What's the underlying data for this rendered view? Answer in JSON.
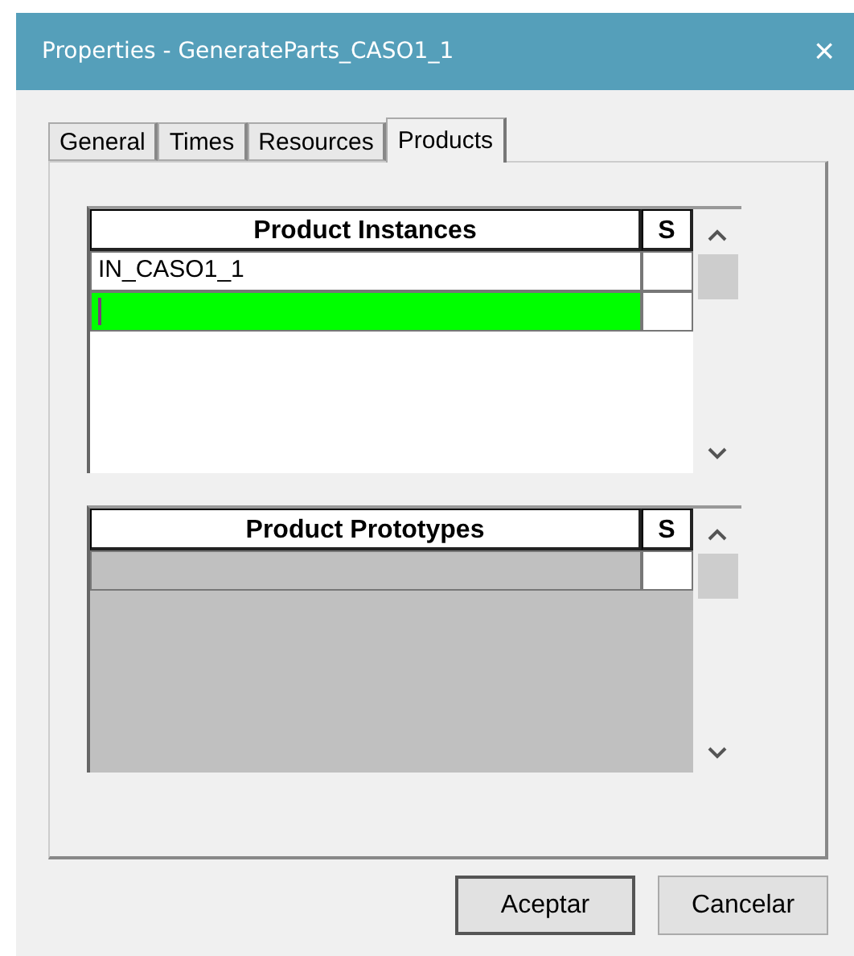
{
  "window": {
    "title": "Properties - GenerateParts_CASO1_1",
    "close": "×"
  },
  "tabs": [
    {
      "label": "General",
      "selected": false
    },
    {
      "label": "Times",
      "selected": false
    },
    {
      "label": "Resources",
      "selected": false
    },
    {
      "label": "Products",
      "selected": true
    }
  ],
  "grids": [
    {
      "columns": [
        "Product Instances",
        "S"
      ],
      "disabled": false,
      "rows": [
        {
          "name": "IN_CASO1_1",
          "selected": false
        },
        {
          "selected": true
        }
      ]
    },
    {
      "columns": [
        "Product Prototypes",
        "S"
      ],
      "disabled": true,
      "rows": [
        {
          "selected": false
        }
      ]
    }
  ],
  "buttons": [
    {
      "label": "Aceptar",
      "default": true
    },
    {
      "label": "Cancelar",
      "default": false
    }
  ]
}
